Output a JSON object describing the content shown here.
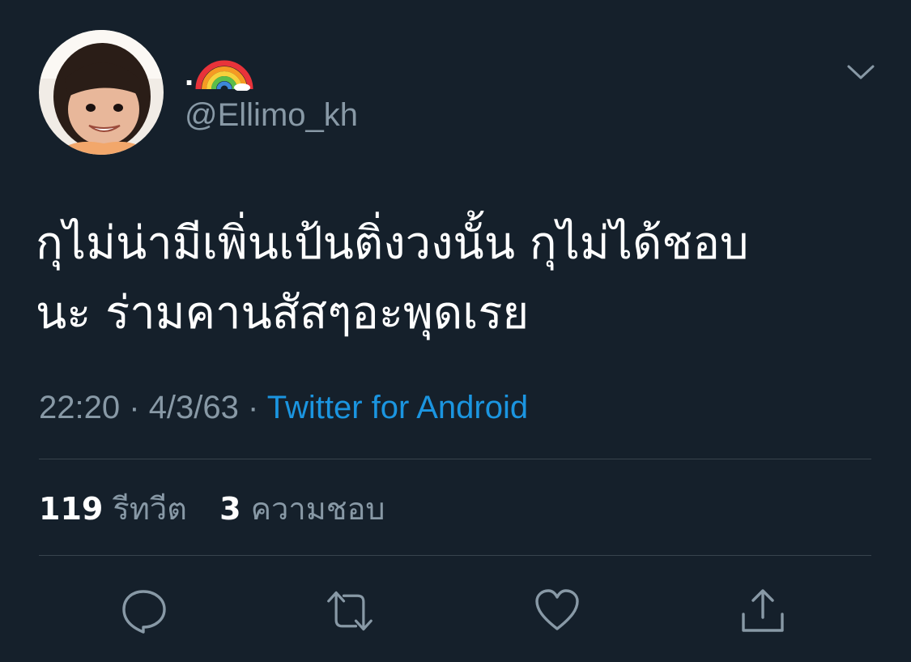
{
  "user": {
    "display_name_dot": ".",
    "display_name_emoji": "rainbow-emoji",
    "handle": "@Ellimo_kh",
    "avatar": "profile-photo"
  },
  "tweet": {
    "lines": [
      "กุไม่น่ามีเพิ่นเป้นติ่งวงนั้น กุไม่ได้ชอบ",
      "นะ ร่ามคานสัสๆอะพุดเรย"
    ],
    "time": "22:20",
    "separator": "·",
    "date": "4/3/63",
    "source": "Twitter for Android"
  },
  "stats": {
    "retweets_count": "119",
    "retweets_label": "รีทวีต",
    "likes_count": "3",
    "likes_label": "ความชอบ"
  },
  "actions": [
    "reply-icon",
    "retweet-icon",
    "like-icon",
    "share-icon"
  ],
  "colors": {
    "background": "#15202b",
    "secondary_text": "#8899a6",
    "link": "#1b95e0",
    "divider": "#38444d"
  }
}
